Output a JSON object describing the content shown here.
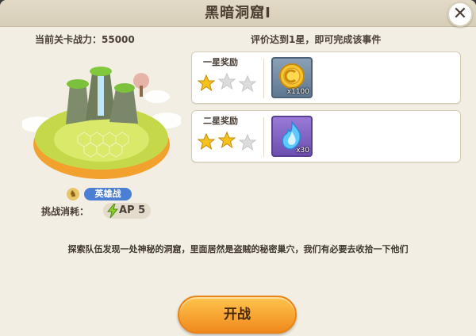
{
  "dialog": {
    "title": "黑暗洞窟Ⅰ",
    "close_symbol": "✕"
  },
  "stage": {
    "power_label": "当前关卡战力：55000",
    "mode_badge": "英雄战",
    "mode_icon": "hero-icon",
    "cost_label": "挑战消耗：",
    "cost_value": "AP 5",
    "cost_icon": "lightning-bolt-icon"
  },
  "rewards": {
    "requirement": "评价达到1星，即可完成该事件",
    "items": [
      {
        "title": "一星奖励",
        "stars_earned": 1,
        "stars_total": 3,
        "item_icon": "gold-coin-icon",
        "quantity": "x1100"
      },
      {
        "title": "二星奖励",
        "stars_earned": 2,
        "stars_total": 3,
        "item_icon": "blue-flame-icon",
        "quantity": "x30"
      }
    ]
  },
  "description": "探索队伍发现一处神秘的洞窟，里面居然是盗贼的秘密巢穴，我们有必要去收拾一下他们",
  "actions": {
    "start_label": "开战"
  },
  "colors": {
    "panel_bg": "#f3eee3",
    "badge_blue": "#4b7fd3",
    "button_orange": "#f08a1d",
    "star_gold": "#f5c21c",
    "star_empty": "#d9d9d9"
  }
}
